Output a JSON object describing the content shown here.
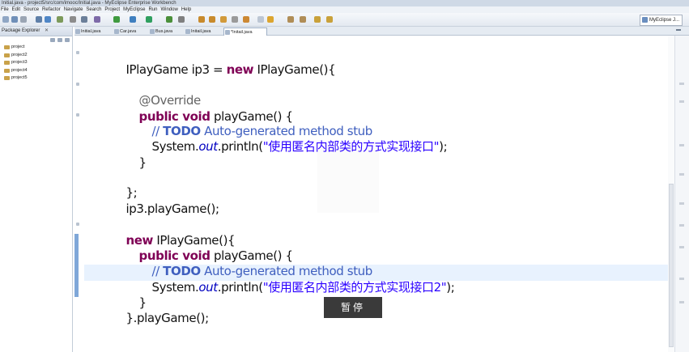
{
  "window": {
    "title": "Initial.java - project5/src/com/imooc/Initial.java - MyEclipse Enterprise Workbench"
  },
  "menu": [
    "File",
    "Edit",
    "Source",
    "Refactor",
    "Navigate",
    "Search",
    "Project",
    "MyEclipse",
    "Run",
    "Window",
    "Help"
  ],
  "perspective": {
    "label": "MyEclipse J..."
  },
  "package_explorer": {
    "title": "Package Explorer",
    "close": "✕",
    "projects": [
      "project",
      "project2",
      "project3",
      "project4",
      "project5"
    ]
  },
  "editor_tabs": [
    {
      "label": "Initial.java"
    },
    {
      "label": "Car.java"
    },
    {
      "label": "Bus.java"
    },
    {
      "label": "Initail.java"
    },
    {
      "label": "*Initail.java",
      "active": true
    }
  ],
  "code": {
    "l1_a": "IPlayGame ip3 = ",
    "l1_kw": "new",
    "l1_b": " IPlayGame(){",
    "l2": "@Override",
    "l3_kw": "public void",
    "l3_b": " playGame() {",
    "l4_a": "// ",
    "l4_todo": "TODO",
    "l4_b": " Auto-generated method stub",
    "l5_a": "System.",
    "l5_out": "out",
    "l5_b": ".println(",
    "l5_str": "\"使用匿名内部类的方式实现接口\"",
    "l5_c": ");",
    "l6": "}",
    "l7": "};",
    "l8": "ip3.playGame();",
    "l9_kw": "new",
    "l9_b": " IPlayGame(){",
    "l10_kw": "public void",
    "l10_b": " playGame() {",
    "l11_a": "// ",
    "l11_todo": "TODO",
    "l11_b": " Auto-generated method stub",
    "l12_a": "System.",
    "l12_out": "out",
    "l12_b": ".println(",
    "l12_str": "\"使用匿名内部类的方式实现接口2\"",
    "l12_c": ");",
    "l13": "}",
    "l14": "}.playGame();"
  },
  "overlay": {
    "pause_label": "暂停"
  },
  "colors": {
    "keyword": "#7f0055",
    "comment": "#3f5fbf",
    "string": "#2a00ff",
    "annotation": "#646464",
    "current_line": "#e8f2fe"
  }
}
